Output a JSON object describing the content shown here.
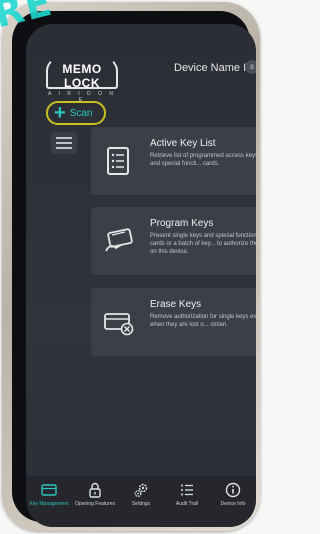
{
  "watermark": "RE",
  "header": {
    "logo_main": "MEMO LOCK",
    "logo_sub": "A I R I D O N E",
    "device_name": "Device Name I",
    "avatar_letter": "s"
  },
  "toolbar": {
    "scan_label": "Scan",
    "scan_icon": "plus-icon",
    "menu_icon": "list-icon"
  },
  "cards": [
    {
      "icon": "list-card-icon",
      "title": "Active Key List",
      "description": "Retrieve list of programmed access keys and special functi... cards."
    },
    {
      "icon": "card-program-icon",
      "title": "Program Keys",
      "description": "Present single keys and special function cards or a batch of key... to authorize them on this device."
    },
    {
      "icon": "card-erase-icon",
      "title": "Erase Keys",
      "description": "Remove authorization for single keys even when they are lost o... stolen."
    }
  ],
  "tabs": [
    {
      "label": "Key Management",
      "icon": "key-management-icon",
      "active": true
    },
    {
      "label": "Opening Features",
      "icon": "lock-icon",
      "active": false
    },
    {
      "label": "Settings",
      "icon": "gears-icon",
      "active": false
    },
    {
      "label": "Audit Trail",
      "icon": "audit-list-icon",
      "active": false
    },
    {
      "label": "Device Info",
      "icon": "info-icon",
      "active": false
    }
  ],
  "colors": {
    "accent": "#2ec4bd",
    "scan_highlight": "#c9c021",
    "watermark": "#1fd7d0"
  }
}
